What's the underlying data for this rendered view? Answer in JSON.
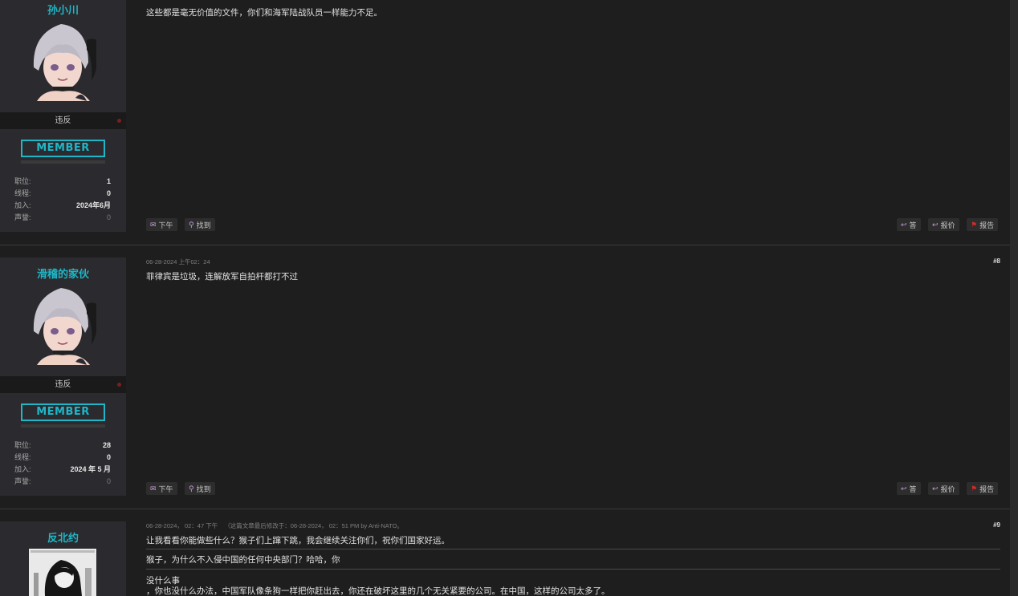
{
  "posts": [
    {
      "username": "孙小川",
      "status": "违反",
      "rank": "MEMBER",
      "stats": [
        {
          "label": "职位:",
          "value": "1"
        },
        {
          "label": "线程:",
          "value": "0"
        },
        {
          "label": "加入:",
          "value": "2024年6月"
        },
        {
          "label": "声誉:",
          "value": "0"
        }
      ],
      "lines": [
        "这些都是毫无价值的文件，你们和海军陆战队员一样能力不足。"
      ]
    },
    {
      "username": "滑稽的家伙",
      "status": "违反",
      "rank": "MEMBER",
      "meta": "06-28-2024 上午02：24",
      "number": "#8",
      "stats": [
        {
          "label": "职位:",
          "value": "28"
        },
        {
          "label": "线程:",
          "value": "0"
        },
        {
          "label": "加入:",
          "value": "2024 年 5 月"
        },
        {
          "label": "声誉:",
          "value": "0"
        }
      ],
      "lines": [
        "菲律宾是垃圾，连解放军自拍杆都打不过"
      ]
    },
    {
      "username": "反北约",
      "meta": "06-28-2024， 02：47 下午",
      "meta_edit": "（这篇文章最后修改于：06-28-2024， 02：51 PM by Anti-NATO。",
      "number": "#9",
      "lines": [
        "让我看看你能做些什么？猴子们上蹿下跳，我会继续关注你们，祝你们国家好运。",
        "猴子，为什么不入侵中国的任何中央部门？哈哈，你",
        "没什么事",
        "，你也没什么办法，中国军队像条狗一样把你赶出去，你还在破坏这里的几个无关紧要的公司。在中国，这样的公司太多了。"
      ]
    }
  ],
  "actions": {
    "pm": "下午",
    "find": "找到",
    "reply": "答",
    "quote": "报价",
    "report": "报告"
  },
  "colors": {
    "username": "#1fb7c8",
    "rank_border": "#1fb7c8",
    "panel_bg": "#2b2a2e",
    "page_bg": "#1e1e1e",
    "report_flag": "#d12b2b",
    "icon_accent": "#c79bd9"
  },
  "icons": {
    "pm": "envelope-icon",
    "find": "search-icon",
    "reply": "reply-icon",
    "quote": "reply-all-icon",
    "report": "flag-icon"
  }
}
